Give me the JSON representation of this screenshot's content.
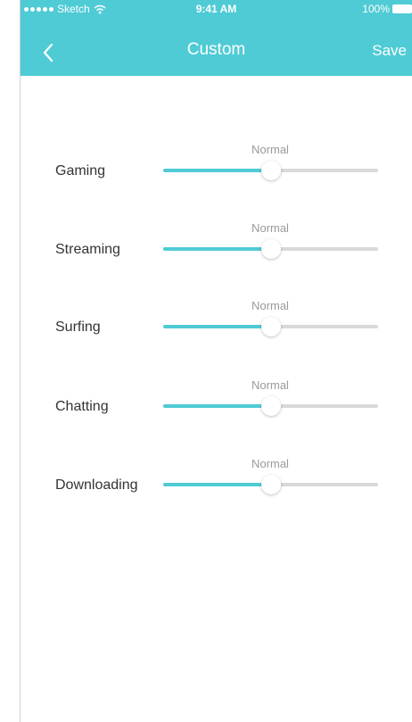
{
  "status_bar": {
    "carrier": "Sketch",
    "time": "9:41 AM",
    "battery": "100%"
  },
  "nav": {
    "title": "Custom",
    "save_label": "Save"
  },
  "sliders": [
    {
      "label": "Gaming",
      "level_label": "Normal",
      "value": 0.5
    },
    {
      "label": "Streaming",
      "level_label": "Normal",
      "value": 0.5
    },
    {
      "label": "Surfing",
      "level_label": "Normal",
      "value": 0.5
    },
    {
      "label": "Chatting",
      "level_label": "Normal",
      "value": 0.5
    },
    {
      "label": "Downloading",
      "level_label": "Normal",
      "value": 0.5
    }
  ],
  "colors": {
    "accent": "#4fcbd5",
    "track": "#d9d9d9"
  }
}
